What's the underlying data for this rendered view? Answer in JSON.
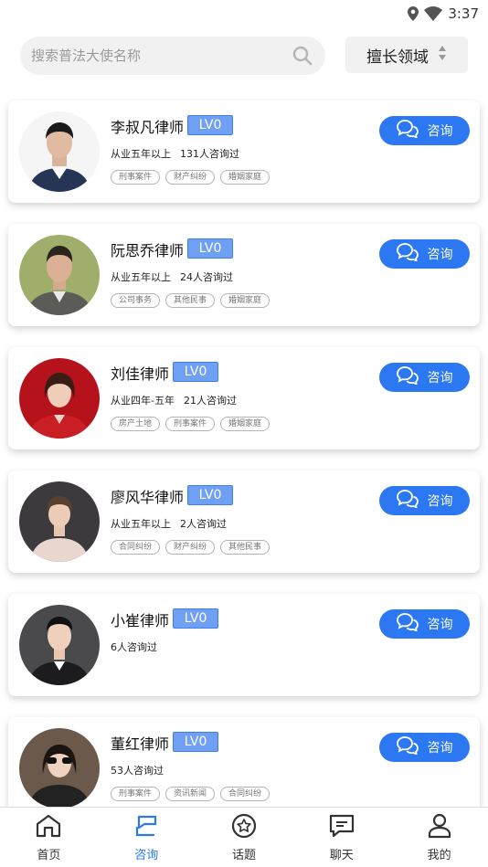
{
  "status_bar": {
    "time": "3:37"
  },
  "search": {
    "placeholder": "搜索普法大使名称"
  },
  "domain_filter": {
    "label": "擅长领域"
  },
  "lawyers": [
    {
      "name": "李叔凡律师",
      "level": "LV0",
      "experience": "从业五年以上",
      "consults": "131人咨询过",
      "tags": [
        "刑事案件",
        "财产纠纷",
        "婚姻家庭"
      ],
      "button": "咨询"
    },
    {
      "name": "阮思乔律师",
      "level": "LV0",
      "experience": "从业五年以上",
      "consults": "24人咨询过",
      "tags": [
        "公司事务",
        "其他民事",
        "婚姻家庭"
      ],
      "button": "咨询"
    },
    {
      "name": "刘佳律师",
      "level": "LV0",
      "experience": "从业四年-五年",
      "consults": "21人咨询过",
      "tags": [
        "房产土地",
        "刑事案件",
        "婚姻家庭"
      ],
      "button": "咨询"
    },
    {
      "name": "廖风华律师",
      "level": "LV0",
      "experience": "从业五年以上",
      "consults": "2人咨询过",
      "tags": [
        "合同纠纷",
        "财产纠纷",
        "其他民事"
      ],
      "button": "咨询"
    },
    {
      "name": "小崔律师",
      "level": "LV0",
      "experience": "",
      "consults": "6人咨询过",
      "tags": [],
      "button": "咨询"
    },
    {
      "name": "董红律师",
      "level": "LV0",
      "experience": "",
      "consults": "53人咨询过",
      "tags": [
        "刑事案件",
        "资讯新闻",
        "合同纠纷"
      ],
      "button": "咨询"
    }
  ],
  "tabbar": {
    "items": [
      {
        "label": "首页",
        "icon": "home-icon",
        "active": false
      },
      {
        "label": "咨询",
        "icon": "consult-icon",
        "active": true
      },
      {
        "label": "话题",
        "icon": "topic-star-icon",
        "active": false
      },
      {
        "label": "聊天",
        "icon": "chat-icon",
        "active": false
      },
      {
        "label": "我的",
        "icon": "profile-icon",
        "active": false
      }
    ]
  },
  "colors": {
    "accent": "#2b78f2",
    "level_badge": "#6fa0f4"
  }
}
